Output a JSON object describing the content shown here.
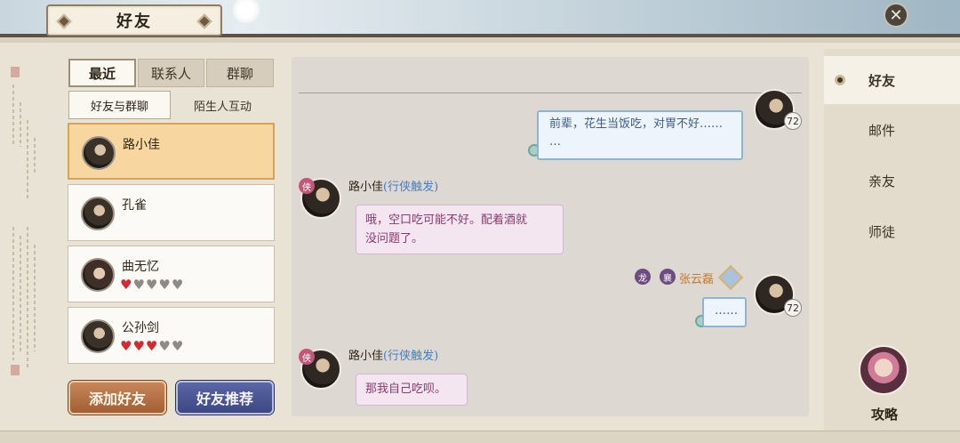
{
  "window": {
    "title": "好友",
    "close_icon": "close-icon"
  },
  "left_panel": {
    "tabs": [
      {
        "label": "最近",
        "active": true
      },
      {
        "label": "联系人",
        "active": false
      },
      {
        "label": "群聊",
        "active": false
      }
    ],
    "subtabs": [
      {
        "label": "好友与群聊",
        "active": true
      },
      {
        "label": "陌生人互动",
        "active": false
      }
    ],
    "friends": [
      {
        "name": "路小佳",
        "selected": true,
        "hearts": null
      },
      {
        "name": "孔雀",
        "selected": false,
        "hearts": null
      },
      {
        "name": "曲无忆",
        "selected": false,
        "hearts": {
          "filled": 1,
          "total": 5
        }
      },
      {
        "name": "公孙剑",
        "selected": false,
        "hearts": {
          "filled": 3,
          "total": 5
        }
      }
    ],
    "add_friend_label": "添加好友",
    "recommend_label": "好友推荐"
  },
  "chat": {
    "messages": [
      {
        "side": "right",
        "text": "前辈，花生当饭吃，对胃不好…… …",
        "level": "72"
      },
      {
        "side": "left",
        "sender": "路小佳",
        "trigger": "(行侠触发)",
        "text_lines": [
          "哦，空口吃可能不好。配着酒就",
          "没问题了。"
        ]
      },
      {
        "side": "right",
        "sender": "张云磊",
        "title_chip": "襄",
        "text": "……",
        "level": "72"
      },
      {
        "side": "left",
        "sender": "路小佳",
        "trigger": "(行侠触发)",
        "text": "那我自己吃呗。"
      }
    ]
  },
  "right_nav": {
    "items": [
      {
        "label": "好友",
        "active": true
      },
      {
        "label": "邮件",
        "active": false
      },
      {
        "label": "亲友",
        "active": false
      },
      {
        "label": "师徒",
        "active": false
      }
    ],
    "guide_label": "攻略"
  },
  "colors": {
    "selected_row": "#f7d79f",
    "add_button": "#b06b3f",
    "recommend_button": "#4a559a",
    "heart_on": "#d6292f",
    "heart_off": "#8e8a86",
    "trigger_text": "#3f7fc9",
    "npc_bubble": "#f3e6f1",
    "self_bubble": "#eef4fb"
  }
}
